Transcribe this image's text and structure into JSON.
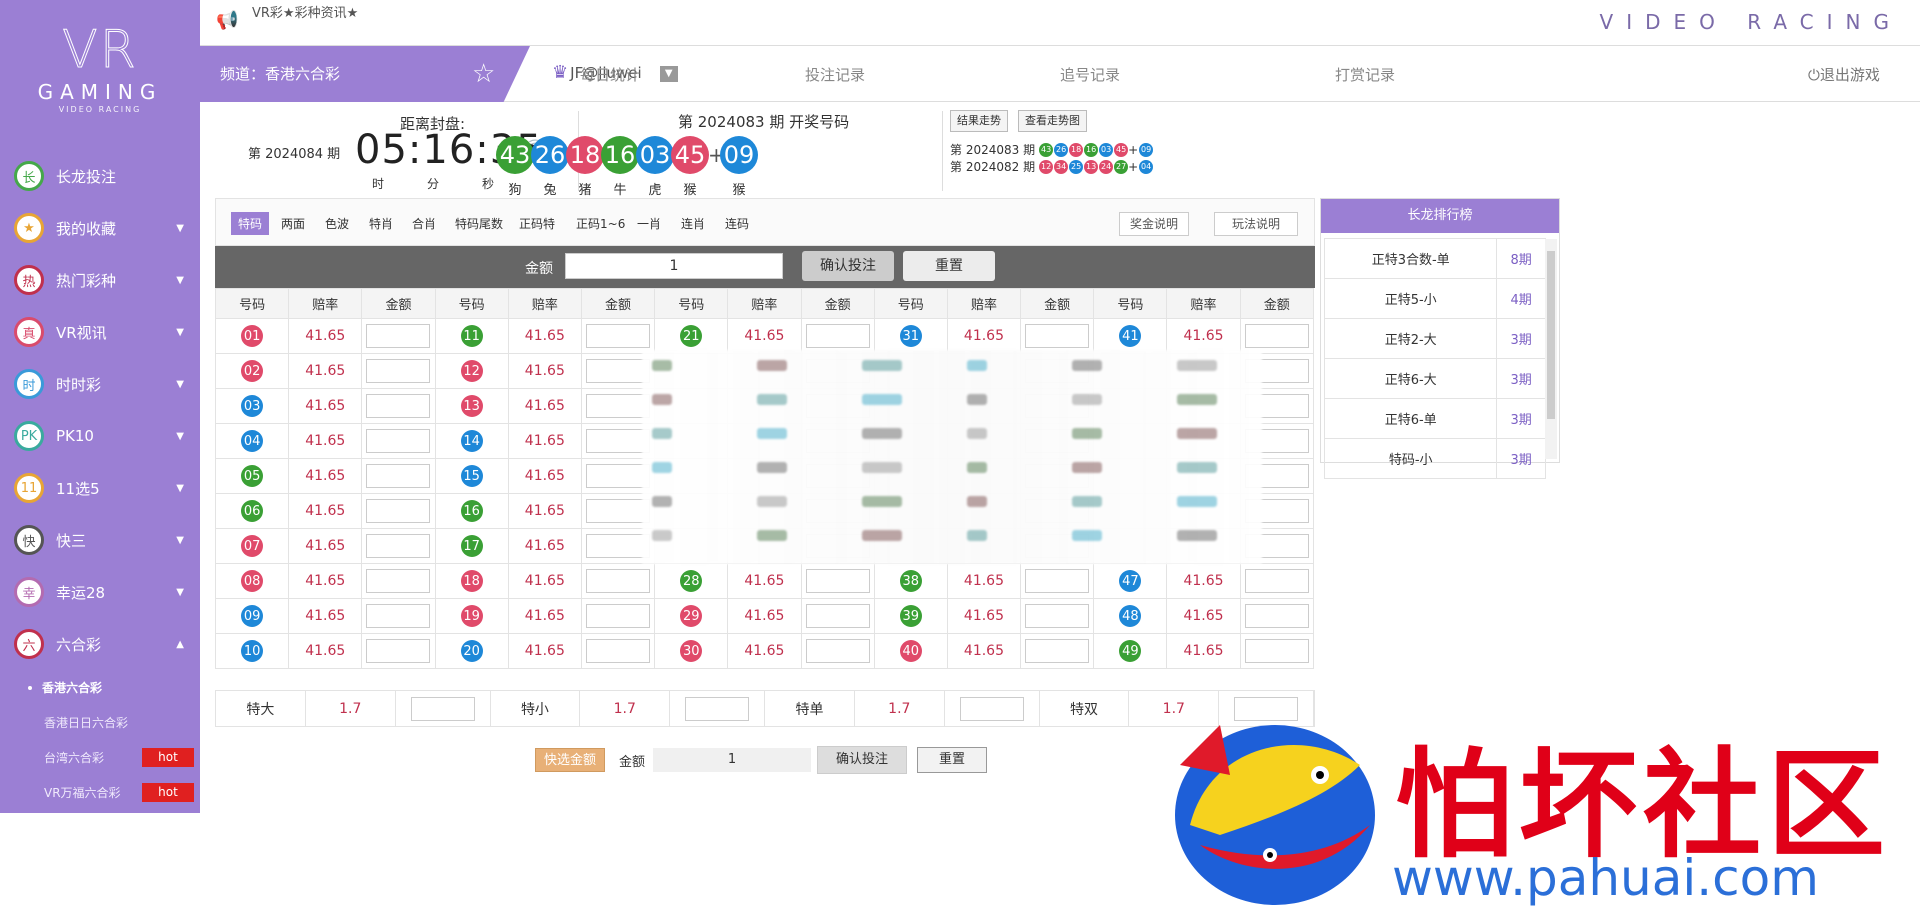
{
  "topbar": {
    "ticker": "VR彩★彩种资讯★",
    "brand": "VIDEO RACING"
  },
  "logo": {
    "main": "VR",
    "sub": "GAMING",
    "tag": "VIDEO RACING"
  },
  "sidebar": {
    "items": [
      {
        "icon": "长",
        "label": "长龙投注",
        "color": "#45a84a",
        "arrow": ""
      },
      {
        "icon": "★",
        "label": "我的收藏",
        "color": "#e8a535",
        "arrow": "▼"
      },
      {
        "icon": "热",
        "label": "热门彩种",
        "color": "#c0304d",
        "arrow": "▼"
      },
      {
        "icon": "真",
        "label": "VR视讯",
        "color": "#d94b6c",
        "arrow": "▼"
      },
      {
        "icon": "时",
        "label": "时时彩",
        "color": "#3a9ad9",
        "arrow": "▼"
      },
      {
        "icon": "PK",
        "label": "PK10",
        "color": "#3aaa9e",
        "arrow": "▼"
      },
      {
        "icon": "11",
        "label": "11选5",
        "color": "#e8a535",
        "arrow": "▼"
      },
      {
        "icon": "快",
        "label": "快三",
        "color": "#555555",
        "arrow": "▼"
      },
      {
        "icon": "幸",
        "label": "幸运28",
        "color": "#b36bb0",
        "arrow": "▼"
      },
      {
        "icon": "六",
        "label": "六合彩",
        "color": "#c0304d",
        "arrow": "▲"
      }
    ],
    "sub_items": [
      {
        "label": "香港六合彩",
        "hot": ""
      },
      {
        "label": "香港日日六合彩",
        "hot": ""
      },
      {
        "label": "台湾六合彩",
        "hot": "hot"
      },
      {
        "label": "VR万福六合彩",
        "hot": "hot"
      }
    ]
  },
  "nav": {
    "channel": "频道：香港六合彩",
    "user": "JF@jiuwei",
    "links": [
      "每日统计",
      "投注记录",
      "追号记录",
      "打赏记录"
    ],
    "logout": "退出游戏"
  },
  "draw": {
    "period": "第 2024084 期",
    "countdown_label": "距离封盘:",
    "countdown": "05:16:35",
    "units": [
      "时",
      "分",
      "秒"
    ],
    "result_title": "第 2024083 期  开奖号码",
    "balls": [
      {
        "n": "43",
        "color": "#3aa035",
        "z": "狗"
      },
      {
        "n": "26",
        "color": "#1e88d8",
        "z": "兔"
      },
      {
        "n": "18",
        "color": "#e04a6a",
        "z": "猪"
      },
      {
        "n": "16",
        "color": "#3aa035",
        "z": "牛"
      },
      {
        "n": "03",
        "color": "#1e88d8",
        "z": "虎"
      },
      {
        "n": "45",
        "color": "#e04a6a",
        "z": "猴"
      }
    ],
    "special": {
      "n": "09",
      "color": "#1e88d8",
      "z": "猴"
    },
    "btn_trend": "结果走势",
    "btn_trend_chart": "查看走势图",
    "history": [
      {
        "period": "第 2024083 期",
        "balls": [
          {
            "n": "43",
            "c": "#3aa035"
          },
          {
            "n": "26",
            "c": "#1e88d8"
          },
          {
            "n": "18",
            "c": "#e04a6a"
          },
          {
            "n": "16",
            "c": "#3aa035"
          },
          {
            "n": "03",
            "c": "#1e88d8"
          },
          {
            "n": "45",
            "c": "#e04a6a"
          }
        ],
        "special": {
          "n": "09",
          "c": "#1e88d8"
        }
      },
      {
        "period": "第 2024082 期",
        "balls": [
          {
            "n": "12",
            "c": "#e04a6a"
          },
          {
            "n": "34",
            "c": "#e04a6a"
          },
          {
            "n": "25",
            "c": "#1e88d8"
          },
          {
            "n": "13",
            "c": "#e04a6a"
          },
          {
            "n": "24",
            "c": "#e04a6a"
          },
          {
            "n": "27",
            "c": "#3aa035"
          }
        ],
        "special": {
          "n": "04",
          "c": "#1e88d8"
        }
      }
    ]
  },
  "tabs": [
    "特码",
    "两面",
    "色波",
    "特肖",
    "合肖",
    "特码尾数",
    "正码特",
    "正码1~6",
    "一肖",
    "连肖",
    "连码"
  ],
  "tab_buttons": [
    "奖金说明",
    "玩法说明"
  ],
  "amount": {
    "label": "金额",
    "value": "1",
    "confirm": "确认投注",
    "reset": "重置"
  },
  "table": {
    "headers": [
      "号码",
      "赔率",
      "金额"
    ],
    "odds": "41.65",
    "rows": [
      [
        {
          "n": "01",
          "c": "#e04a6a"
        },
        {
          "n": "11",
          "c": "#3aa035"
        },
        {
          "n": "21",
          "c": "#3aa035"
        },
        {
          "n": "31",
          "c": "#1e88d8"
        },
        {
          "n": "41",
          "c": "#1e88d8"
        }
      ],
      [
        {
          "n": "02",
          "c": "#e04a6a"
        },
        {
          "n": "12",
          "c": "#e04a6a"
        },
        null,
        null,
        null
      ],
      [
        {
          "n": "03",
          "c": "#1e88d8"
        },
        {
          "n": "13",
          "c": "#e04a6a"
        },
        null,
        null,
        null
      ],
      [
        {
          "n": "04",
          "c": "#1e88d8"
        },
        {
          "n": "14",
          "c": "#1e88d8"
        },
        null,
        null,
        null
      ],
      [
        {
          "n": "05",
          "c": "#3aa035"
        },
        {
          "n": "15",
          "c": "#1e88d8"
        },
        null,
        null,
        null
      ],
      [
        {
          "n": "06",
          "c": "#3aa035"
        },
        {
          "n": "16",
          "c": "#3aa035"
        },
        null,
        null,
        null
      ],
      [
        {
          "n": "07",
          "c": "#e04a6a"
        },
        {
          "n": "17",
          "c": "#3aa035"
        },
        null,
        null,
        null
      ],
      [
        {
          "n": "08",
          "c": "#e04a6a"
        },
        {
          "n": "18",
          "c": "#e04a6a"
        },
        {
          "n": "28",
          "c": "#3aa035"
        },
        {
          "n": "38",
          "c": "#3aa035"
        },
        {
          "n": "47",
          "c": "#1e88d8"
        }
      ],
      [
        {
          "n": "09",
          "c": "#1e88d8"
        },
        {
          "n": "19",
          "c": "#e04a6a"
        },
        {
          "n": "29",
          "c": "#e04a6a"
        },
        {
          "n": "39",
          "c": "#3aa035"
        },
        {
          "n": "48",
          "c": "#1e88d8"
        }
      ],
      [
        {
          "n": "10",
          "c": "#1e88d8"
        },
        {
          "n": "20",
          "c": "#1e88d8"
        },
        {
          "n": "30",
          "c": "#e04a6a"
        },
        {
          "n": "40",
          "c": "#e04a6a"
        },
        {
          "n": "49",
          "c": "#3aa035"
        }
      ]
    ]
  },
  "specials": [
    {
      "label": "特大",
      "odds": "1.7"
    },
    {
      "label": "特小",
      "odds": "1.7"
    },
    {
      "label": "特单",
      "odds": "1.7"
    },
    {
      "label": "特双",
      "odds": "1.7"
    }
  ],
  "bottom": {
    "quick": "快选金额",
    "label": "金额",
    "value": "1",
    "confirm": "确认投注",
    "reset": "重置"
  },
  "ranking": {
    "title": "长龙排行榜",
    "rows": [
      {
        "name": "正特3合数-单",
        "periods": "8期"
      },
      {
        "name": "正特5-小",
        "periods": "4期"
      },
      {
        "name": "正特2-大",
        "periods": "3期"
      },
      {
        "name": "正特6-大",
        "periods": "3期"
      },
      {
        "name": "正特6-单",
        "periods": "3期"
      },
      {
        "name": "特码-小",
        "periods": "3期"
      }
    ]
  },
  "watermark": {
    "text": "怕坏社区",
    "url": "www.pahuai.com"
  }
}
